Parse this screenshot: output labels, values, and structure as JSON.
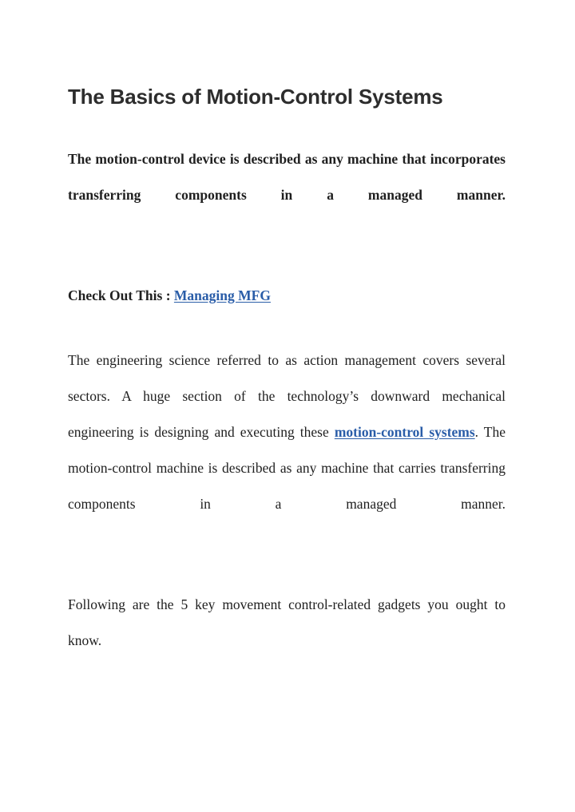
{
  "document": {
    "title": "The Basics of Motion-Control Systems",
    "paragraphs": {
      "lead": "The motion-control device is described as any machine that incorporates transferring components in a managed manner.",
      "callout_prefix": "Check Out This : ",
      "callout_link": "Managing MFG",
      "body_before_link": "The engineering science referred to as action management covers several sectors. A huge section of the technology’s downward mechanical engineering is designing and executing these ",
      "body_link": "motion-control systems",
      "body_after_link": ". The motion-control machine is described as any machine that carries transferring components in a managed manner.",
      "closing": "Following are the 5 key movement control-related gadgets you ought to know."
    },
    "colors": {
      "page_background": "#ffffff",
      "title_text": "#2d2d2d",
      "body_text": "#1f1f1f",
      "link": "#2a5da8"
    }
  }
}
